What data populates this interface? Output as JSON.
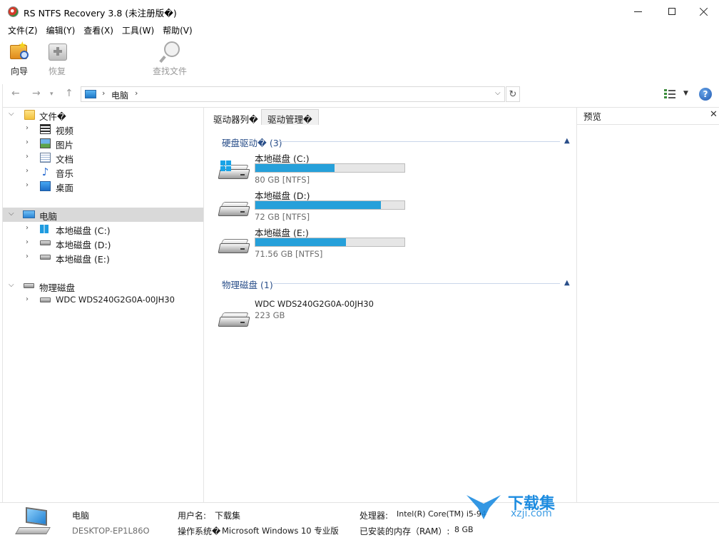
{
  "window": {
    "title": "RS NTFS Recovery 3.8 (未注册版�)"
  },
  "menu": [
    "文件(Z)",
    "编辑(Y)",
    "查看(X)",
    "工具(W)",
    "帮助(V)"
  ],
  "toolbar": {
    "wizard": "向导",
    "restore": "恢复",
    "find": "查找文件"
  },
  "address": {
    "path": "电脑"
  },
  "tree": {
    "files_label": "文件�",
    "files_children": [
      "视频",
      "图片",
      "文档",
      "音乐",
      "桌面"
    ],
    "computer_label": "电脑",
    "computer_children": [
      "本地磁盘 (C:)",
      "本地磁盘 (D:)",
      "本地磁盘 (E:)"
    ],
    "physical_label": "物理磁盘",
    "physical_children": [
      "WDC WDS240G2G0A-00JH30"
    ]
  },
  "tabs": [
    "驱动器列�",
    "驱动管理�"
  ],
  "sections": {
    "hard": {
      "title": "硬盘驱动�",
      "count": "(3)"
    },
    "physical": {
      "title": "物理磁盘",
      "count": "(1)"
    }
  },
  "drives": [
    {
      "name": "本地磁盘 (C:)",
      "info": "80 GB [NTFS]",
      "used_fraction": 0.53
    },
    {
      "name": "本地磁盘 (D:)",
      "info": "72 GB [NTFS]",
      "used_fraction": 0.84
    },
    {
      "name": "本地磁盘 (E:)",
      "info": "71.56 GB [NTFS]",
      "used_fraction": 0.61
    }
  ],
  "physical_disks": [
    {
      "name": "WDC WDS240G2G0A-00JH30",
      "info": "223 GB"
    }
  ],
  "preview": {
    "title": "预览"
  },
  "status": {
    "name": "电脑",
    "host": "DESKTOP-EP1L86O",
    "user_label": "用户名:",
    "user_value": "下载集",
    "os_label": "操作系统�",
    "os_value": "Microsoft Windows 10 专业版",
    "cpu_label": "处理器:",
    "cpu_value": "Intel(R) Core(TM) i5-94",
    "ram_label": "已安装的内存（RAM）:",
    "ram_value": "8 GB"
  },
  "watermark": {
    "brand": "下载集",
    "url": "xzji.com"
  },
  "colors": {
    "accent": "#26a0da",
    "section_header": "#2a4f8a",
    "selection": "#d9d9d9"
  }
}
